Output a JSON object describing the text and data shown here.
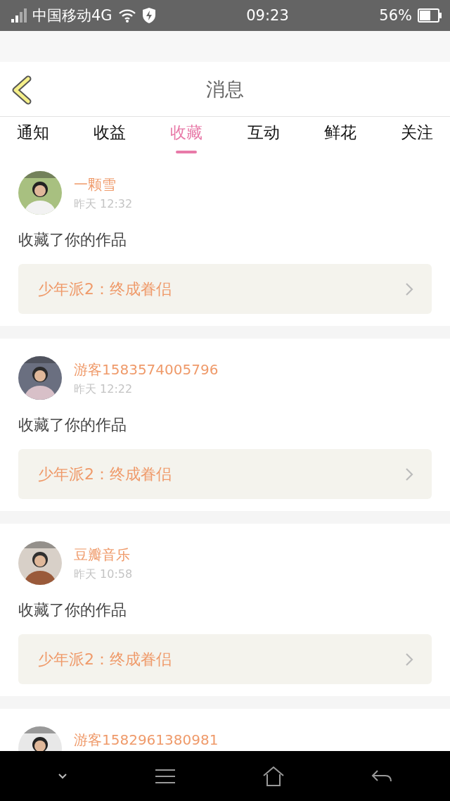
{
  "status_bar": {
    "carrier": "中国移动4G",
    "time": "09:23",
    "battery": "56%"
  },
  "header": {
    "title": "消息"
  },
  "tabs": [
    {
      "label": "通知",
      "selected": false
    },
    {
      "label": "收益",
      "selected": false
    },
    {
      "label": "收藏",
      "selected": true
    },
    {
      "label": "互动",
      "selected": false
    },
    {
      "label": "鲜花",
      "selected": false
    },
    {
      "label": "关注",
      "selected": false
    }
  ],
  "messages": [
    {
      "name": "一颗雪",
      "time": "昨天 12:32",
      "action": "收藏了你的作品",
      "work": "少年派2：终成眷侣"
    },
    {
      "name": "游客1583574005796",
      "time": "昨天 12:22",
      "action": "收藏了你的作品",
      "work": "少年派2：终成眷侣"
    },
    {
      "name": "豆瓣音乐",
      "time": "昨天 10:58",
      "action": "收藏了你的作品",
      "work": "少年派2：终成眷侣"
    },
    {
      "name": "游客1582961380981"
    }
  ]
}
